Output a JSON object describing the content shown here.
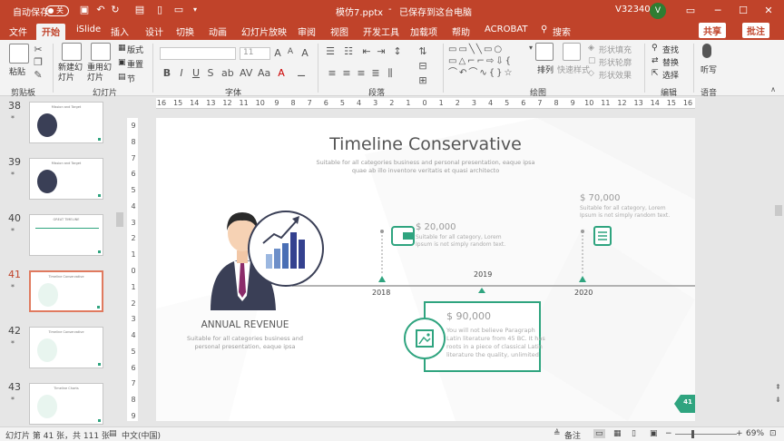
{
  "titlebar": {
    "autosave_label": "自动保存",
    "autosave_state": "关",
    "filename": "模仿7.pptx",
    "save_status": "已保存到这台电脑",
    "user_id": "V32340",
    "user_initial": "V"
  },
  "tabs": [
    "文件",
    "开始",
    "iSlide",
    "插入",
    "设计",
    "切换",
    "动画",
    "幻灯片放映",
    "审阅",
    "视图",
    "开发工具",
    "加载项",
    "帮助",
    "ACROBAT",
    "搜索"
  ],
  "active_tab": "开始",
  "share_label": "共享",
  "comment_label": "批注",
  "ribbon": {
    "clipboard": {
      "label": "剪贴板",
      "paste": "粘贴"
    },
    "slides": {
      "label": "幻灯片",
      "new_slide": "新建幻灯片",
      "reuse_slide": "重用幻灯片",
      "layout": "版式",
      "reset": "重置",
      "section": "节"
    },
    "font": {
      "label": "字体",
      "font_size": "11"
    },
    "paragraph": {
      "label": "段落"
    },
    "drawing": {
      "label": "绘图",
      "arrange": "排列",
      "quick_styles": "快速样式",
      "shape_fill": "形状填充",
      "shape_outline": "形状轮廓",
      "shape_effects": "形状效果"
    },
    "editing": {
      "label": "编辑",
      "find": "查找",
      "replace": "替换",
      "select": "选择"
    },
    "voice": {
      "label": "语音",
      "dictate": "听写"
    }
  },
  "ruler_labels": [
    "16",
    "15",
    "14",
    "13",
    "12",
    "11",
    "10",
    "9",
    "8",
    "7",
    "6",
    "5",
    "4",
    "3",
    "2",
    "1",
    "0",
    "1",
    "2",
    "3",
    "4",
    "5",
    "6",
    "7",
    "8",
    "9",
    "10",
    "11",
    "12",
    "13",
    "14",
    "15",
    "16"
  ],
  "vruler_labels": [
    "9",
    "8",
    "7",
    "6",
    "5",
    "4",
    "3",
    "2",
    "1",
    "0",
    "1",
    "2",
    "3",
    "4",
    "5",
    "6",
    "7",
    "8",
    "9"
  ],
  "thumbnails": [
    {
      "num": "38",
      "caption": "Mission and Target"
    },
    {
      "num": "39",
      "caption": "Mission and Target"
    },
    {
      "num": "40",
      "caption": "GREAT TIMELINE"
    },
    {
      "num": "41",
      "caption": "Timeline Conservative",
      "selected": true
    },
    {
      "num": "42",
      "caption": "Timeline Conservative"
    },
    {
      "num": "43",
      "caption": "Timeline Charts"
    }
  ],
  "slide": {
    "title": "Timeline Conservative",
    "subtitle_1": "Suitable for all categories business and personal presentation, eaque ipsa",
    "subtitle_2": "quae ab illo inventore veritatis et quasi architecto",
    "revenue_title": "ANNUAL REVENUE",
    "revenue_desc_1": "Suitable for all categories business and",
    "revenue_desc_2": "personal presentation, eaque ipsa",
    "year_2018": "2018",
    "year_2019": "2019",
    "year_2020": "2020",
    "amount_20000": "$ 20,000",
    "desc_20000_1": "Suitable for all category, Lorem",
    "desc_20000_2": "Ipsum is not simply random text.",
    "amount_70000": "$ 70,000",
    "desc_70000_1": "Suitable for all category, Lorem",
    "desc_70000_2": "Ipsum is not simply random text.",
    "amount_90000": "$ 90,000",
    "desc_90000_1": "You will not believe Paragraph",
    "desc_90000_2": "Latin literature from 45 BC. It has",
    "desc_90000_3": "roots in a piece of classical Latin",
    "desc_90000_4": "literature the quality, unlimited",
    "page_badge": "41"
  },
  "status": {
    "slide_info": "幻灯片 第 41 张，共 111 张",
    "language": "中文(中国)",
    "notes": "备注",
    "zoom": "69%"
  },
  "colors": {
    "accent": "#c0432a",
    "teal": "#2fa47f",
    "navy": "#34418f"
  }
}
